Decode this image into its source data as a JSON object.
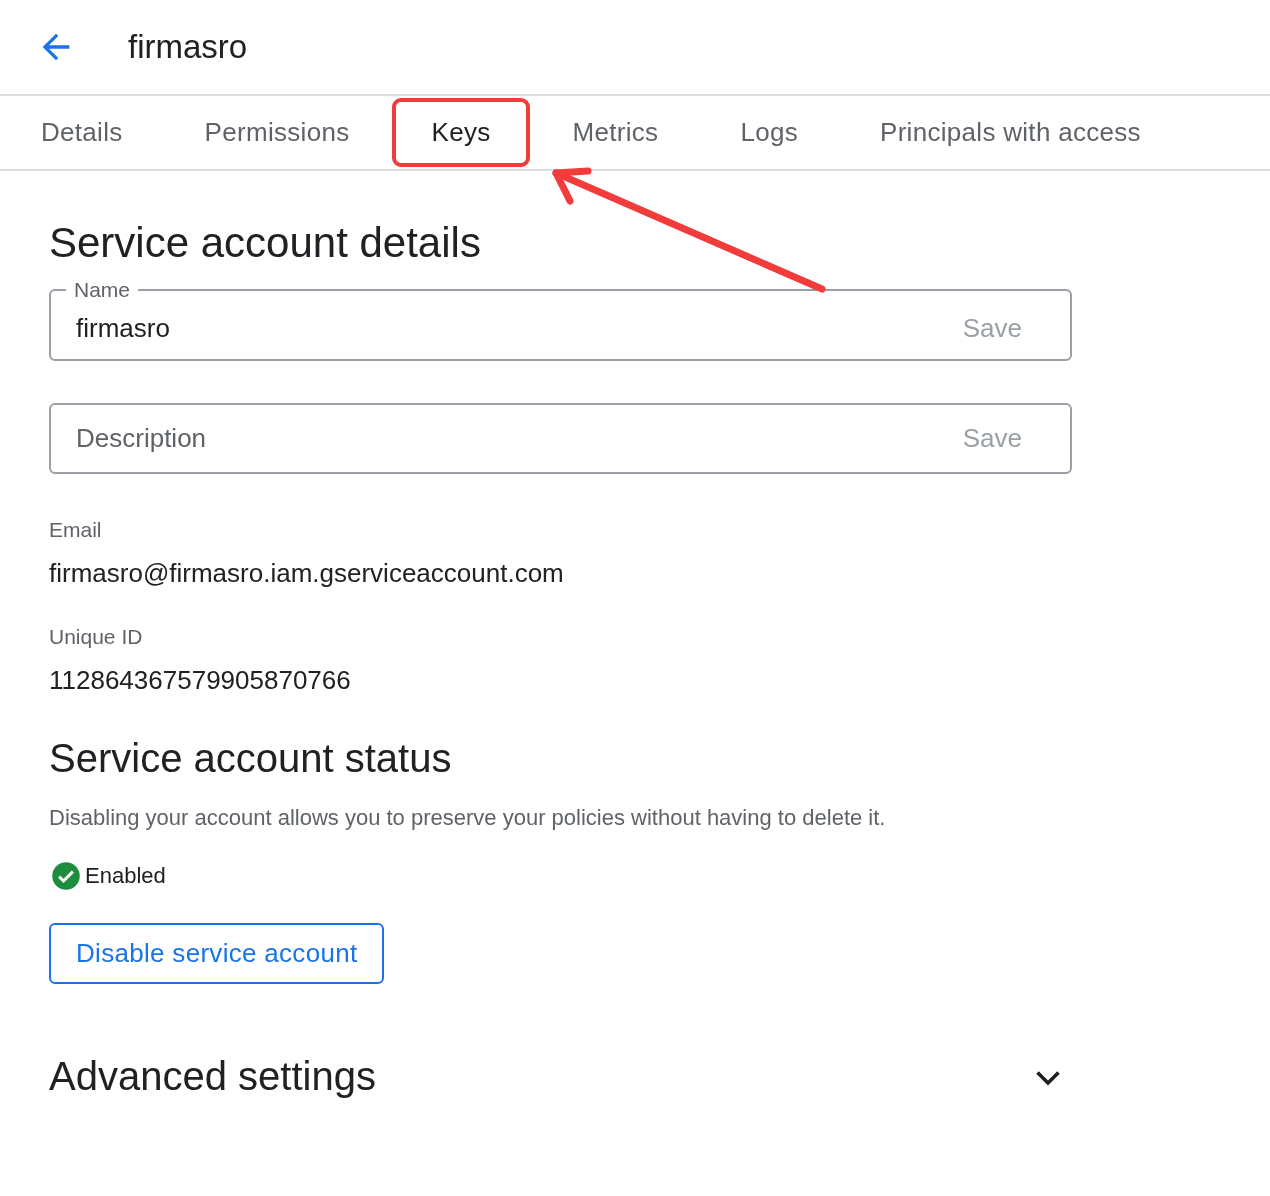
{
  "header": {
    "title": "firmasro"
  },
  "tabs": [
    {
      "label": "Details",
      "selected": false,
      "annotated": false
    },
    {
      "label": "Permissions",
      "selected": false,
      "annotated": false
    },
    {
      "label": "Keys",
      "selected": true,
      "annotated": true
    },
    {
      "label": "Metrics",
      "selected": false,
      "annotated": false
    },
    {
      "label": "Logs",
      "selected": false,
      "annotated": false
    },
    {
      "label": "Principals with access",
      "selected": false,
      "annotated": false
    }
  ],
  "details": {
    "heading": "Service account details",
    "fields": [
      {
        "label": "Name",
        "value": "firmasro",
        "action": "Save"
      },
      {
        "placeholder": "Description",
        "action": "Save"
      }
    ],
    "info": [
      {
        "label": "Email",
        "value": "firmasro@firmasro.iam.gserviceaccount.com"
      },
      {
        "label": "Unique ID",
        "value": "112864367579905870766"
      }
    ]
  },
  "status": {
    "heading": "Service account status",
    "description": "Disabling your account allows you to preserve your policies without having to delete it.",
    "enabled": true,
    "state_label": "Enabled",
    "button": "Disable service account"
  },
  "advanced": {
    "heading": "Advanced settings",
    "expanded": false
  }
}
